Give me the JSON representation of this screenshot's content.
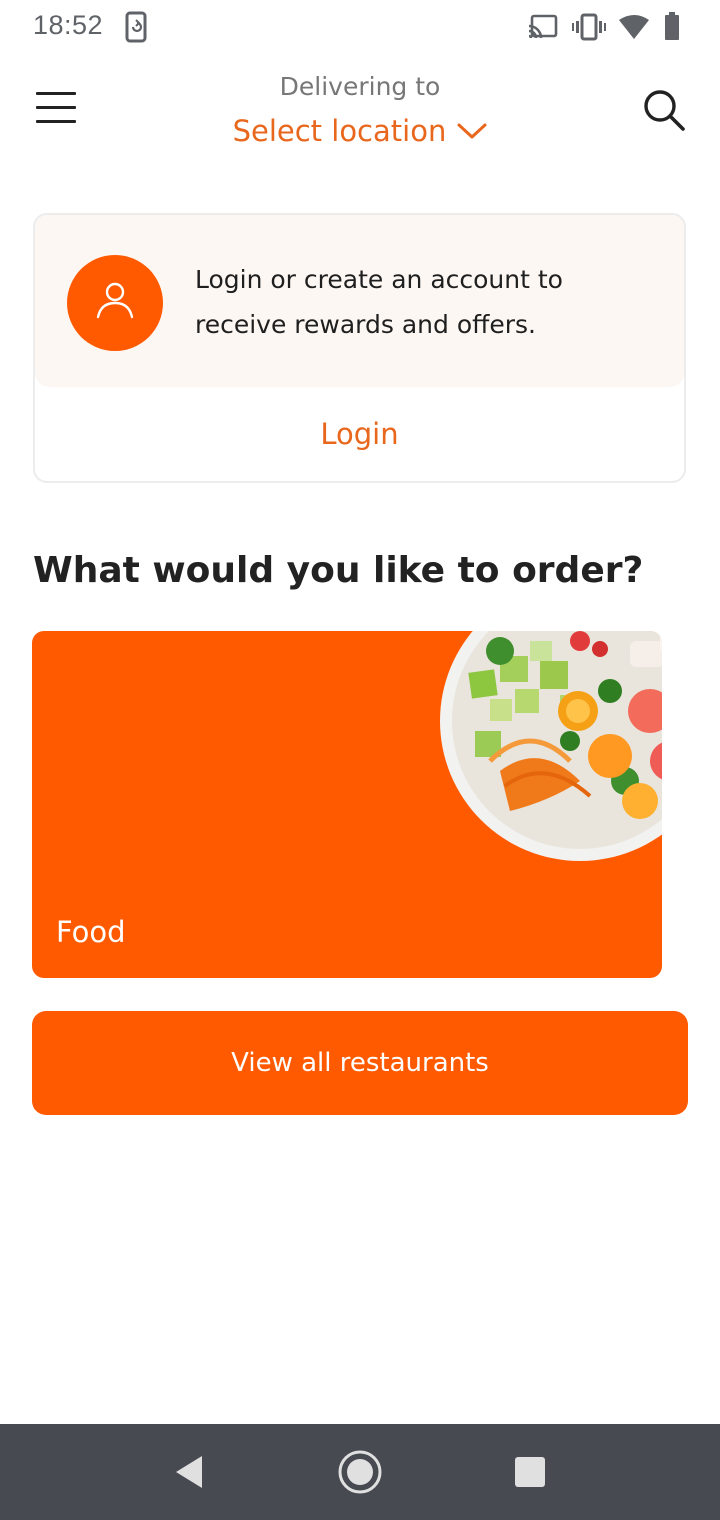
{
  "status_bar": {
    "time": "18:52",
    "icons": [
      "screen-rotate-icon",
      "cast-icon",
      "vibrate-icon",
      "wifi-icon",
      "battery-icon"
    ]
  },
  "header": {
    "subtitle": "Delivering to",
    "location_label": "Select location",
    "menu_icon": "hamburger-menu-icon",
    "search_icon": "search-icon"
  },
  "login_card": {
    "message": "Login or create an account to receive rewards and offers.",
    "login_label": "Login",
    "avatar_icon": "user-icon"
  },
  "order_section": {
    "title": "What would you like to order?",
    "categories": [
      {
        "label": "Food",
        "image": "poke-bowl-image"
      }
    ]
  },
  "cta": {
    "label": "View all restaurants"
  },
  "nav_bar": {
    "buttons": [
      "back-icon",
      "home-icon",
      "recents-icon"
    ]
  },
  "colors": {
    "accent": "#ff5a00",
    "accent_text": "#e8671c",
    "card_tint": "#fcf7f3",
    "nav_bg": "#474a51"
  }
}
